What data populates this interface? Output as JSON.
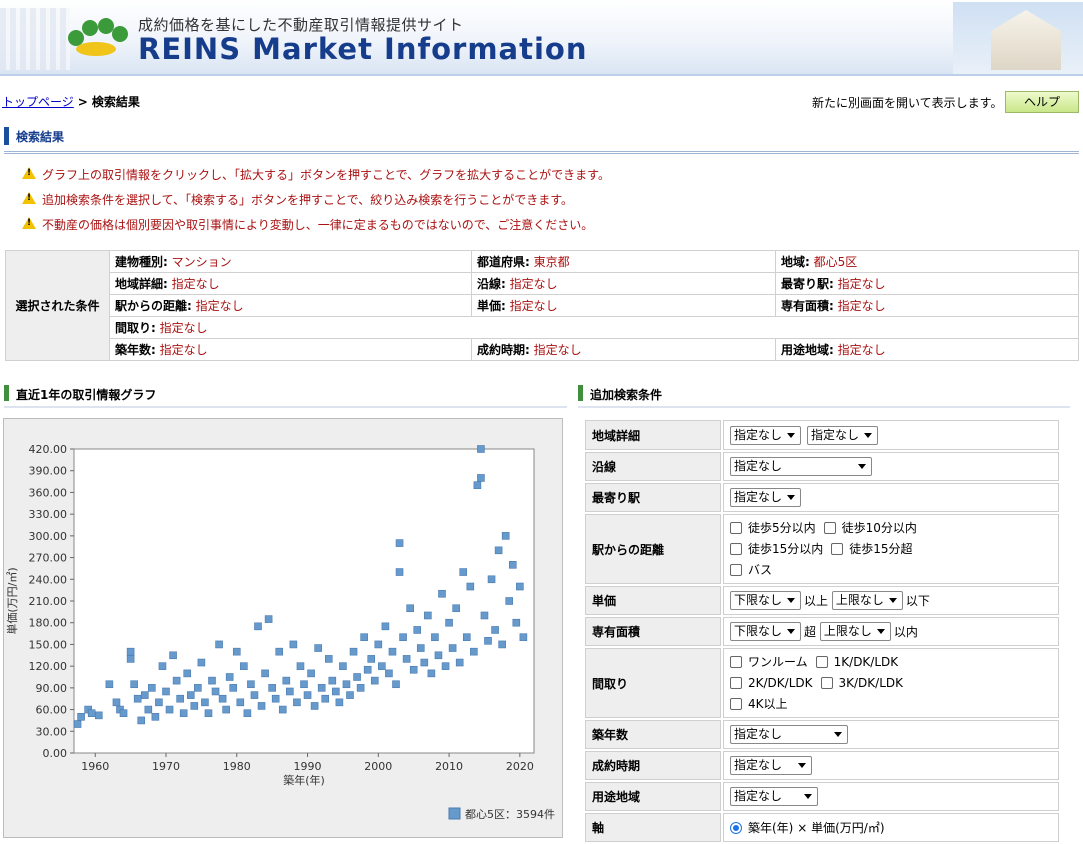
{
  "header": {
    "tagline": "成約価格を基にした不動産取引情報提供サイト",
    "title": "REINS Market Information"
  },
  "breadcrumb": {
    "home": "トップページ",
    "separator": ">",
    "current": "検索結果"
  },
  "new_window_text": "新たに別画面を開いて表示します。",
  "help_button": "ヘルプ",
  "section_title": "検索結果",
  "notices": [
    "グラフ上の取引情報をクリックし、「拡大する」ボタンを押すことで、グラフを拡大することができます。",
    "追加検索条件を選択して、「検索する」ボタンを押すことで、絞り込み検索を行うことができます。",
    "不動産の価格は個別要因や取引事情により変動し、一律に定まるものではないので、ご注意ください。"
  ],
  "conditions": {
    "label": "選択された条件",
    "building_type": {
      "k": "建物種別:",
      "v": "マンション"
    },
    "prefecture": {
      "k": "都道府県:",
      "v": "東京都"
    },
    "area": {
      "k": "地域:",
      "v": "都心5区"
    },
    "area_detail": {
      "k": "地域詳細:",
      "v": "指定なし"
    },
    "line": {
      "k": "沿線:",
      "v": "指定なし"
    },
    "station": {
      "k": "最寄り駅:",
      "v": "指定なし"
    },
    "distance": {
      "k": "駅からの距離:",
      "v": "指定なし"
    },
    "unit_price": {
      "k": "単価:",
      "v": "指定なし"
    },
    "floor_area": {
      "k": "専有面積:",
      "v": "指定なし"
    },
    "layout": {
      "k": "間取り:",
      "v": "指定なし"
    },
    "age": {
      "k": "築年数:",
      "v": "指定なし"
    },
    "deal_time": {
      "k": "成約時期:",
      "v": "指定なし"
    },
    "zoning": {
      "k": "用途地域:",
      "v": "指定なし"
    }
  },
  "graph_title": "直近1年の取引情報グラフ",
  "add_title": "追加検索条件",
  "add": {
    "area_detail": {
      "label": "地域詳細",
      "sel1": "指定なし",
      "sel2": "指定なし"
    },
    "line": {
      "label": "沿線",
      "sel": "指定なし"
    },
    "station": {
      "label": "最寄り駅",
      "sel": "指定なし"
    },
    "distance": {
      "label": "駅からの距離",
      "opts": [
        "徒歩5分以内",
        "徒歩10分以内",
        "徒歩15分以内",
        "徒歩15分超",
        "バス"
      ]
    },
    "unit_price": {
      "label": "単価",
      "low": "下限なし",
      "mid": "以上",
      "high": "上限なし",
      "tail": "以下"
    },
    "floor_area": {
      "label": "専有面積",
      "low": "下限なし",
      "mid": "超",
      "high": "上限なし",
      "tail": "以内"
    },
    "layout": {
      "label": "間取り",
      "opts": [
        "ワンルーム",
        "1K/DK/LDK",
        "2K/DK/LDK",
        "3K/DK/LDK",
        "4K以上"
      ]
    },
    "age": {
      "label": "築年数",
      "sel": "指定なし"
    },
    "deal_time": {
      "label": "成約時期",
      "sel": "指定なし"
    },
    "zoning": {
      "label": "用途地域",
      "sel": "指定なし"
    },
    "axis": {
      "label": "軸",
      "opt": "築年(年)",
      "times": "×",
      "opt2": "単価(万円/㎡)"
    }
  },
  "chart_data": {
    "type": "scatter",
    "xlabel": "築年(年)",
    "ylabel": "単価(万円/㎡)",
    "xlim": [
      1957,
      2022
    ],
    "ylim": [
      0,
      420
    ],
    "xticks": [
      "1960",
      "1970",
      "1980",
      "1990",
      "2000",
      "2010",
      "2020"
    ],
    "yticks": [
      "0.00",
      "30.00",
      "60.00",
      "90.00",
      "120.00",
      "150.00",
      "180.00",
      "210.00",
      "240.00",
      "270.00",
      "300.00",
      "330.00",
      "360.00",
      "390.00",
      "420.00"
    ],
    "color": "#6699cc",
    "legend": "都心5区：3594件",
    "series": [
      {
        "name": "都心5区",
        "points": [
          [
            1957.5,
            40
          ],
          [
            1958,
            50
          ],
          [
            1959,
            60
          ],
          [
            1959.5,
            55
          ],
          [
            1960.5,
            52
          ],
          [
            1962,
            95
          ],
          [
            1963,
            70
          ],
          [
            1963.5,
            60
          ],
          [
            1964,
            55
          ],
          [
            1965,
            140
          ],
          [
            1965,
            130
          ],
          [
            1965.5,
            95
          ],
          [
            1966,
            75
          ],
          [
            1966.5,
            45
          ],
          [
            1967,
            80
          ],
          [
            1967.5,
            60
          ],
          [
            1968,
            90
          ],
          [
            1968.5,
            50
          ],
          [
            1969,
            70
          ],
          [
            1969.5,
            120
          ],
          [
            1970,
            85
          ],
          [
            1970.5,
            60
          ],
          [
            1971,
            135
          ],
          [
            1971.5,
            100
          ],
          [
            1972,
            75
          ],
          [
            1972.5,
            55
          ],
          [
            1973,
            110
          ],
          [
            1973.5,
            80
          ],
          [
            1974,
            65
          ],
          [
            1974.5,
            90
          ],
          [
            1975,
            125
          ],
          [
            1975.5,
            70
          ],
          [
            1976,
            55
          ],
          [
            1976.5,
            100
          ],
          [
            1977,
            85
          ],
          [
            1977.5,
            150
          ],
          [
            1978,
            75
          ],
          [
            1978.5,
            60
          ],
          [
            1979,
            105
          ],
          [
            1979.5,
            90
          ],
          [
            1980,
            140
          ],
          [
            1980.5,
            70
          ],
          [
            1981,
            120
          ],
          [
            1981.5,
            55
          ],
          [
            1982,
            95
          ],
          [
            1982.5,
            80
          ],
          [
            1983,
            175
          ],
          [
            1983.5,
            65
          ],
          [
            1984,
            110
          ],
          [
            1984.5,
            185
          ],
          [
            1985,
            90
          ],
          [
            1985.5,
            75
          ],
          [
            1986,
            140
          ],
          [
            1986.5,
            60
          ],
          [
            1987,
            100
          ],
          [
            1987.5,
            85
          ],
          [
            1988,
            150
          ],
          [
            1988.5,
            70
          ],
          [
            1989,
            120
          ],
          [
            1989.5,
            95
          ],
          [
            1990,
            80
          ],
          [
            1990.5,
            110
          ],
          [
            1991,
            65
          ],
          [
            1991.5,
            145
          ],
          [
            1992,
            90
          ],
          [
            1992.5,
            75
          ],
          [
            1993,
            130
          ],
          [
            1993.5,
            100
          ],
          [
            1994,
            85
          ],
          [
            1994.5,
            70
          ],
          [
            1995,
            120
          ],
          [
            1995.5,
            95
          ],
          [
            1996,
            80
          ],
          [
            1996.5,
            140
          ],
          [
            1997,
            105
          ],
          [
            1997.5,
            90
          ],
          [
            1998,
            160
          ],
          [
            1998.5,
            115
          ],
          [
            1999,
            130
          ],
          [
            1999.5,
            100
          ],
          [
            2000,
            150
          ],
          [
            2000.5,
            120
          ],
          [
            2001,
            175
          ],
          [
            2001.5,
            110
          ],
          [
            2002,
            140
          ],
          [
            2002.5,
            95
          ],
          [
            2003,
            290
          ],
          [
            2003,
            250
          ],
          [
            2003.5,
            160
          ],
          [
            2004,
            130
          ],
          [
            2004.5,
            200
          ],
          [
            2005,
            115
          ],
          [
            2005.5,
            170
          ],
          [
            2006,
            145
          ],
          [
            2006.5,
            125
          ],
          [
            2007,
            190
          ],
          [
            2007.5,
            110
          ],
          [
            2008,
            160
          ],
          [
            2008.5,
            135
          ],
          [
            2009,
            220
          ],
          [
            2009.5,
            120
          ],
          [
            2010,
            180
          ],
          [
            2010.5,
            145
          ],
          [
            2011,
            200
          ],
          [
            2011.5,
            125
          ],
          [
            2012,
            250
          ],
          [
            2012.5,
            160
          ],
          [
            2013,
            230
          ],
          [
            2013.5,
            140
          ],
          [
            2014,
            370
          ],
          [
            2014.5,
            420
          ],
          [
            2014.5,
            380
          ],
          [
            2015,
            190
          ],
          [
            2015.5,
            155
          ],
          [
            2016,
            240
          ],
          [
            2016.5,
            170
          ],
          [
            2017,
            280
          ],
          [
            2017.5,
            150
          ],
          [
            2018,
            300
          ],
          [
            2018.5,
            210
          ],
          [
            2019,
            260
          ],
          [
            2019.5,
            180
          ],
          [
            2020,
            230
          ],
          [
            2020.5,
            160
          ]
        ]
      }
    ]
  }
}
